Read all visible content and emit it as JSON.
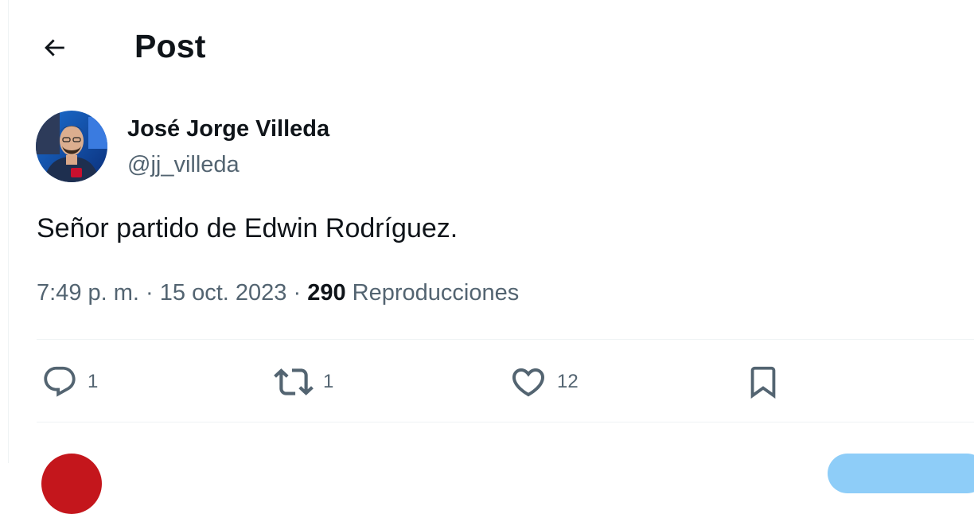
{
  "header": {
    "title": "Post",
    "back_icon": "arrow-left-icon"
  },
  "post": {
    "author_name": "José Jorge Villeda",
    "author_handle": "@jj_villeda",
    "text": "Señor partido de Edwin Rodríguez.",
    "time": "7:49 p. m.",
    "separator": "·",
    "date": "15 oct. 2023",
    "views_count": "290",
    "views_label": "Reproducciones"
  },
  "actions": {
    "reply": {
      "icon": "reply-bubble-icon",
      "count": "1"
    },
    "repost": {
      "icon": "repost-arrows-icon",
      "count": "1"
    },
    "like": {
      "icon": "heart-icon",
      "count": "12"
    },
    "bookmark": {
      "icon": "bookmark-icon"
    }
  },
  "colors": {
    "text_primary": "#0f1419",
    "text_secondary": "#536471",
    "divider": "#eff3f4",
    "accent_peek": "#8ecdf8",
    "avatar_peek": "#c4161c"
  }
}
